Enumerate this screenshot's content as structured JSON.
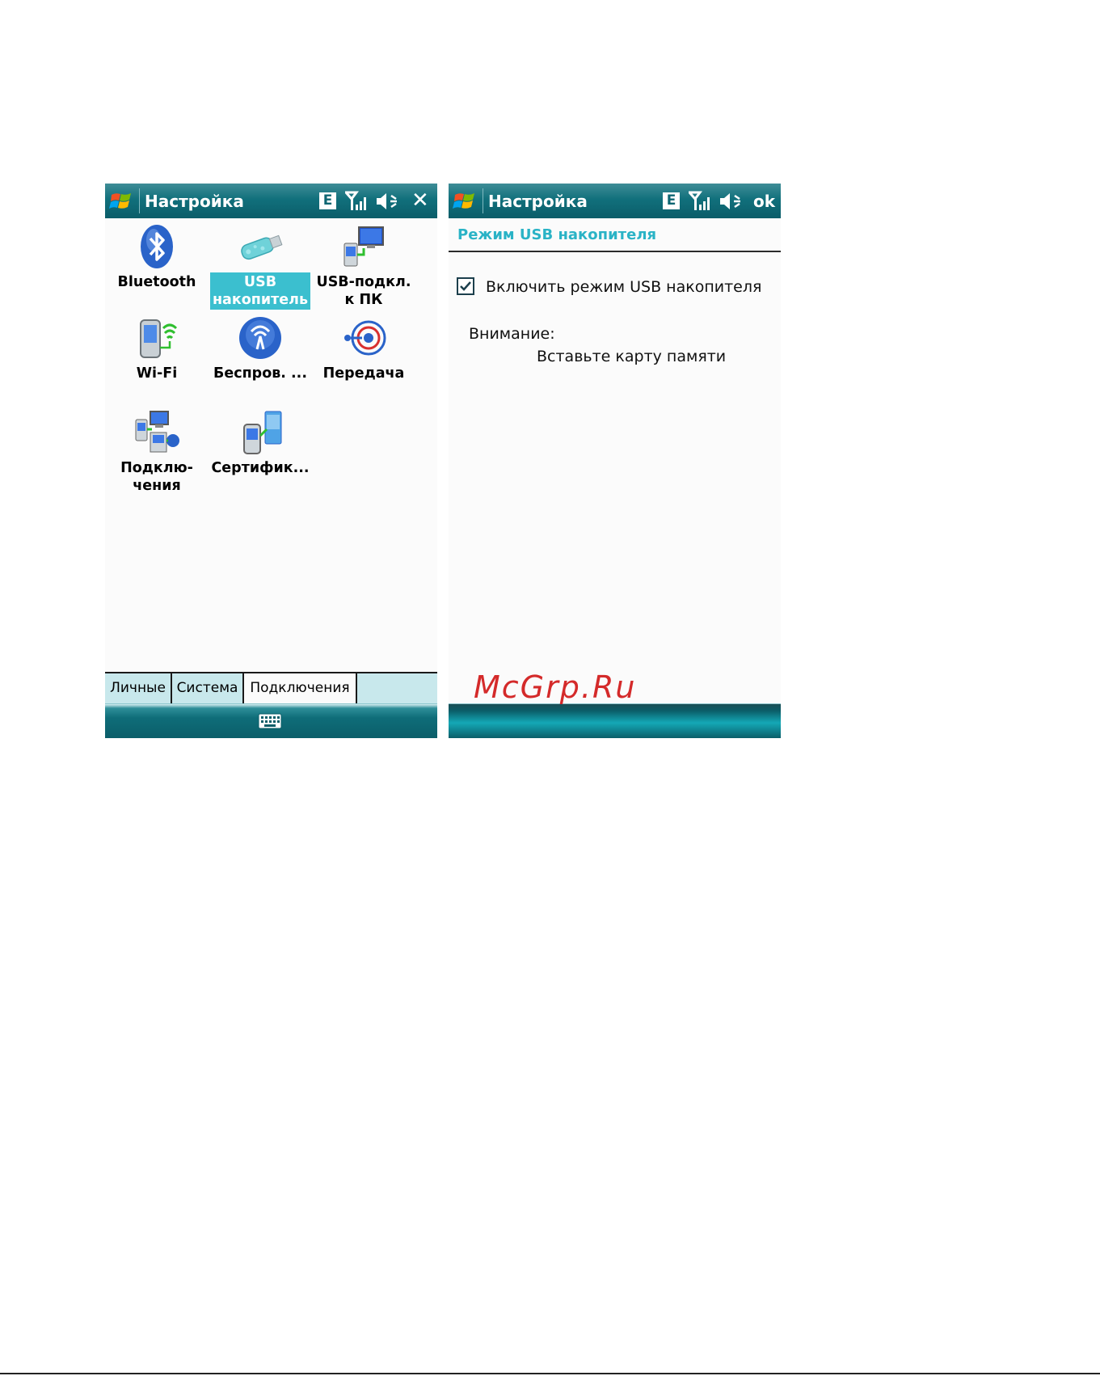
{
  "left_screen": {
    "title": "Настройка",
    "network_badge": "E",
    "close_glyph": "✕",
    "apps": [
      {
        "label": "Bluetooth",
        "icon": "bluetooth-icon",
        "selected": false
      },
      {
        "label": "USB\nнакопитель",
        "icon": "usb-drive-icon",
        "selected": true
      },
      {
        "label": "USB-подкл.\nк ПК",
        "icon": "usb-pc-connection-icon",
        "selected": false
      },
      {
        "label": "Wi-Fi",
        "icon": "wifi-icon",
        "selected": false
      },
      {
        "label": "Беспров. ...",
        "icon": "wireless-manager-icon",
        "selected": false
      },
      {
        "label": "Передача",
        "icon": "beam-icon",
        "selected": false
      },
      {
        "label": "Подклю-\nчения",
        "icon": "connections-icon",
        "selected": false
      },
      {
        "label": "Сертифик...",
        "icon": "certificates-icon",
        "selected": false
      }
    ],
    "tabs": [
      "Личные",
      "Система",
      "Подключения"
    ],
    "active_tab": "Подключения"
  },
  "right_screen": {
    "title": "Настройка",
    "network_badge": "E",
    "ok_label": "ok",
    "section_title": "Режим USB накопителя",
    "checkbox_label": "Включить режим USB накопителя",
    "checkbox_checked": true,
    "warning_title": "Внимание:",
    "warning_text": "Вставьте карту памяти"
  },
  "watermark": "McGrp.Ru",
  "colors": {
    "titlebar": "#0e6672",
    "selection": "#3bbfcf",
    "section_title": "#2ab3c6",
    "watermark": "#d42a2a"
  }
}
